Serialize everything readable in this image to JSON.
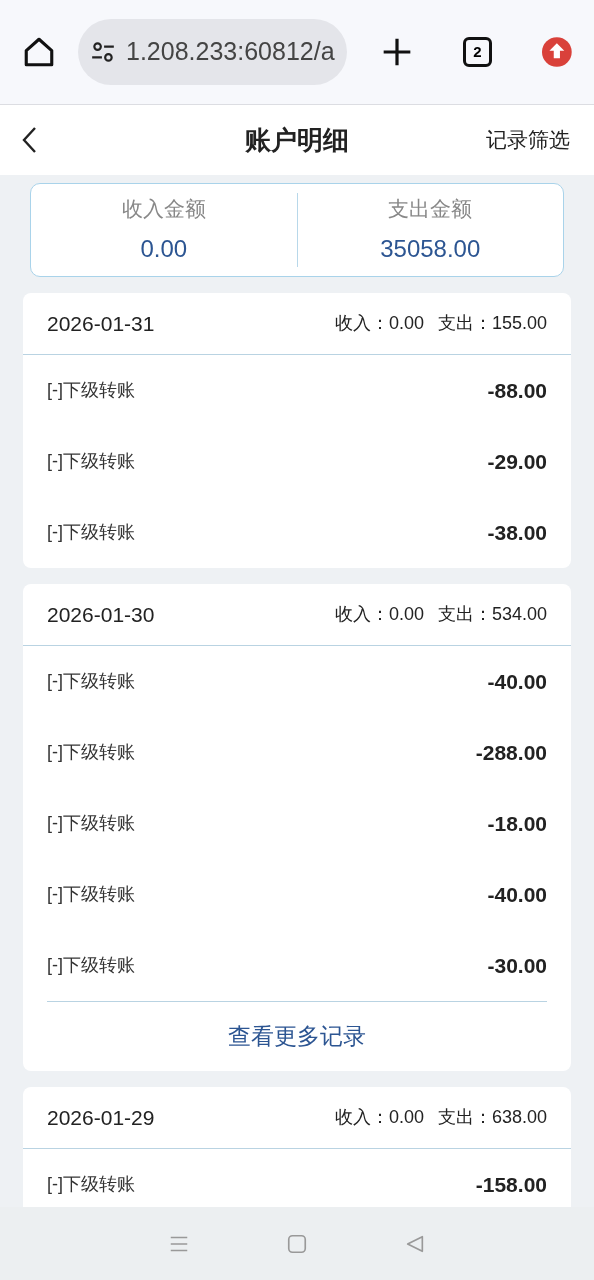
{
  "browser": {
    "url": "1.208.233:60812/a",
    "tab_count": "2"
  },
  "header": {
    "title": "账户明细",
    "action": "记录筛选"
  },
  "summary": [
    {
      "label": "收入金额",
      "value": "0.00"
    },
    {
      "label": "支出金额",
      "value": "35058.00"
    }
  ],
  "groups": [
    {
      "date": "2026-01-31",
      "income": "收入：0.00",
      "expense": "支出：155.00",
      "rows": [
        {
          "label": "[-]下级转账",
          "amount": "-88.00"
        },
        {
          "label": "[-]下级转账",
          "amount": "-29.00"
        },
        {
          "label": "[-]下级转账",
          "amount": "-38.00"
        }
      ]
    },
    {
      "date": "2026-01-30",
      "income": "收入：0.00",
      "expense": "支出：534.00",
      "rows": [
        {
          "label": "[-]下级转账",
          "amount": "-40.00"
        },
        {
          "label": "[-]下级转账",
          "amount": "-288.00"
        },
        {
          "label": "[-]下级转账",
          "amount": "-18.00"
        },
        {
          "label": "[-]下级转账",
          "amount": "-40.00"
        },
        {
          "label": "[-]下级转账",
          "amount": "-30.00"
        }
      ],
      "more": "查看更多记录"
    },
    {
      "date": "2026-01-29",
      "income": "收入：0.00",
      "expense": "支出：638.00",
      "rows": [
        {
          "label": "[-]下级转账",
          "amount": "-158.00"
        }
      ]
    }
  ]
}
